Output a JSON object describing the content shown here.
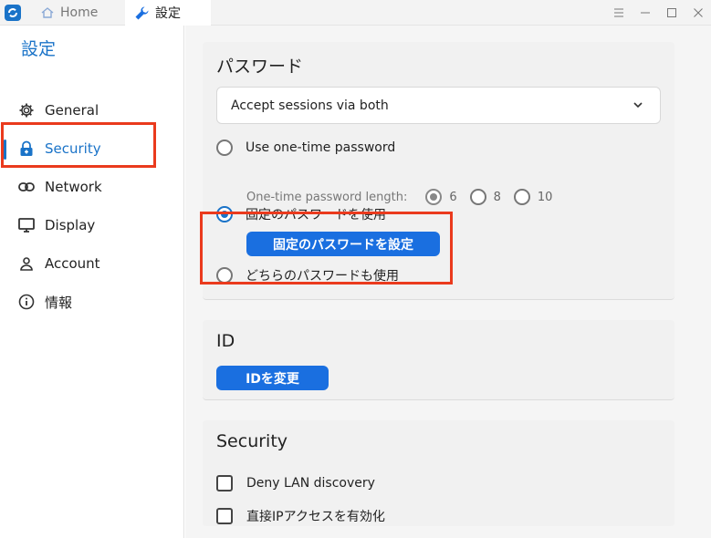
{
  "titlebar": {
    "tabs": [
      {
        "label": "Home",
        "icon": "home-icon"
      },
      {
        "label": "設定",
        "icon": "wrench-icon"
      }
    ],
    "controls": [
      "menu-icon",
      "minimize-icon",
      "maximize-icon",
      "close-icon"
    ]
  },
  "sidebar": {
    "title": "設定",
    "items": [
      {
        "label": "General",
        "icon": "gear-icon"
      },
      {
        "label": "Security",
        "icon": "lock-icon"
      },
      {
        "label": "Network",
        "icon": "link-icon"
      },
      {
        "label": "Display",
        "icon": "monitor-icon"
      },
      {
        "label": "Account",
        "icon": "person-icon"
      },
      {
        "label": "情報",
        "icon": "info-icon"
      }
    ],
    "active_index": 1
  },
  "password": {
    "title": "パスワード",
    "dropdown_value": "Accept sessions via both",
    "otp_label": "Use one-time password",
    "otp_length_label": "One-time password length:",
    "otp_lengths": [
      "6",
      "8",
      "10"
    ],
    "otp_selected": "6",
    "fixed_label": "固定のパスワードを使用",
    "fixed_button": "固定のパスワードを設定",
    "both_label": "どちらのパスワードも使用",
    "selected": "fixed"
  },
  "id": {
    "title": "ID",
    "button": "IDを変更"
  },
  "security": {
    "title": "Security",
    "options": [
      {
        "label": "Deny LAN discovery",
        "checked": false
      },
      {
        "label": "直接IPアクセスを有効化",
        "checked": false
      }
    ]
  },
  "colors": {
    "accent": "#1a73c8",
    "button": "#1a6fe0",
    "highlight": "#ea3a1d"
  }
}
